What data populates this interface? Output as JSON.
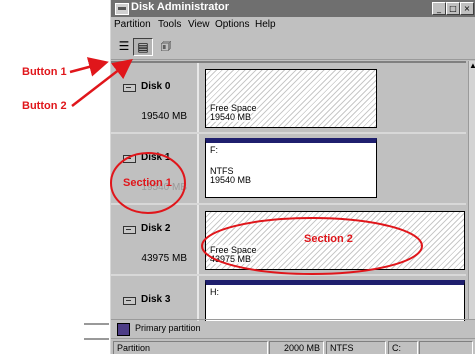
{
  "window": {
    "title": "Disk Administrator",
    "title_buttons": [
      "_",
      "□",
      "×"
    ]
  },
  "menu": [
    "Partition",
    "Tools",
    "View",
    "Options",
    "Help"
  ],
  "toolbar": {
    "buttons": [
      {
        "name": "disks-view-button",
        "icon": "list-view-icon",
        "glyph": "☰"
      },
      {
        "name": "volumes-view-button",
        "icon": "volumes-view-icon",
        "glyph": "▤"
      },
      {
        "name": "properties-button",
        "icon": "properties-icon",
        "glyph": "🗊"
      }
    ]
  },
  "disks": [
    {
      "name": "Disk 0",
      "size": "19540 MB",
      "partition": {
        "type": "free",
        "line1": "Free Space",
        "line2": "19540 MB"
      }
    },
    {
      "name": "Disk 1",
      "size": "19540 MB",
      "partition": {
        "type": "primary",
        "drive": "F:",
        "fs": "NTFS",
        "size": "19540 MB"
      }
    },
    {
      "name": "Disk 2",
      "size": "43975 MB",
      "partition": {
        "type": "free",
        "line1": "Free Space",
        "line2": "43975 MB"
      }
    },
    {
      "name": "Disk 3",
      "size": "",
      "partition": {
        "type": "primary",
        "drive": "H:",
        "fs": "",
        "size": ""
      }
    }
  ],
  "legend": {
    "label": "Primary partition",
    "color": "#4d3d86"
  },
  "status": {
    "left": "Partition",
    "size": "2000 MB",
    "fs": "NTFS",
    "drive": "C:"
  },
  "annotations": {
    "button1": "Button 1",
    "button2": "Button 2",
    "section1": "Section 1",
    "section2": "Section 2",
    "color": "#e0161b"
  }
}
